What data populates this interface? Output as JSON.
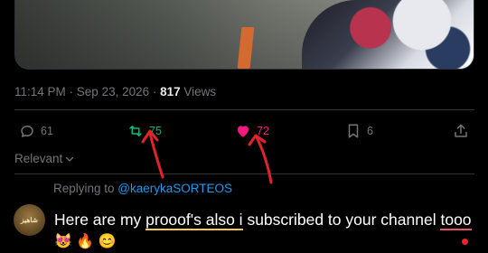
{
  "post": {
    "time": "11:14 PM",
    "separator": " · ",
    "date": "Sep 23, 2026",
    "separator2": " · ",
    "views_count": "817",
    "views_label": " Views"
  },
  "actions": {
    "replies": "61",
    "retweets": "75",
    "likes": "72",
    "bookmarks": "6"
  },
  "sort": {
    "label": "Relevant"
  },
  "reply": {
    "replying_prefix": "Replying to ",
    "replying_handle": "@kaerykaSORTEOS",
    "text_1": "Here are my ",
    "text_highlight_1": "prooof's also i",
    "text_2": " subscribed to your channel ",
    "text_highlight_2": "tooo",
    "emojis": "😻 🔥 😊",
    "avatar_text": "شاهيز"
  },
  "colors": {
    "background": "#000000",
    "muted": "#71767b",
    "retweet": "#00ba7c",
    "like": "#f91880",
    "link": "#1d9bf0",
    "highlight_yellow": "#f2c94c",
    "highlight_red": "#e0556d",
    "annotation_arrow": "#e0242a"
  },
  "icons": [
    "reply-icon",
    "retweet-icon",
    "heart-icon",
    "bookmark-icon",
    "share-icon",
    "chevron-down-icon"
  ]
}
